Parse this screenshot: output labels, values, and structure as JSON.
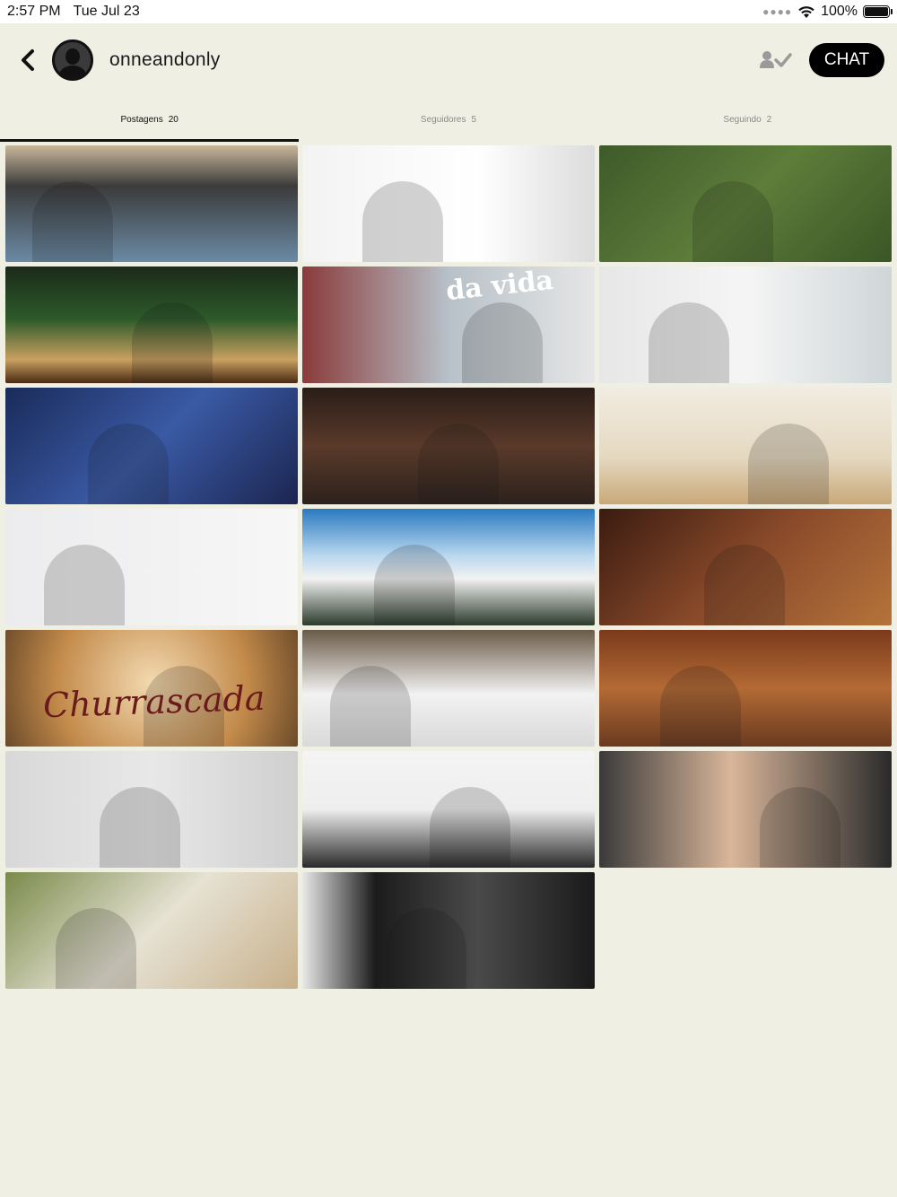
{
  "status_bar": {
    "time": "2:57 PM",
    "date": "Tue Jul 23",
    "battery": "100%"
  },
  "header": {
    "username": "onneandonly",
    "chat_label": "CHAT"
  },
  "tabs": [
    {
      "label": "Postagens",
      "count": "20",
      "active": true
    },
    {
      "label": "Seguidores",
      "count": "5",
      "active": false
    },
    {
      "label": "Seguindo",
      "count": "2",
      "active": false
    }
  ],
  "posts": [
    {
      "name": "post-1",
      "bg": "linear-gradient(180deg,#c9b79a 0%,#3b3b3b 35%,#6b8aa5 100%)"
    },
    {
      "name": "post-2",
      "bg": "linear-gradient(90deg,#f3f3f3 0%,#ffffff 60%,#dcdcdc 100%)"
    },
    {
      "name": "post-3",
      "bg": "linear-gradient(135deg,#3e5a2a 0%,#5d7d3a 50%,#3a5626 100%)"
    },
    {
      "name": "post-4",
      "bg": "linear-gradient(180deg,#1b2a1a 0%,#2d5a2a 45%,#c9a060 80%,#4a2a14 100%)"
    },
    {
      "name": "post-5",
      "bg": "linear-gradient(90deg,#8a3a3a 0%,#b7c1c8 50%,#e6e6e6 100%)",
      "text": "da vida"
    },
    {
      "name": "post-6",
      "bg": "linear-gradient(90deg,#e7e7e7 0%,#f5f5f5 50%,#cfd6d8 100%)"
    },
    {
      "name": "post-7",
      "bg": "linear-gradient(135deg,#1a2b5a 0%,#3a5aa5 50%,#1b2550 100%)"
    },
    {
      "name": "post-8",
      "bg": "linear-gradient(180deg,#2a1d18 0%,#5a3a2a 50%,#2c211c 100%)"
    },
    {
      "name": "post-9",
      "bg": "linear-gradient(180deg,#f1ece2 0%,#e5d8c0 60%,#c9a878 100%)"
    },
    {
      "name": "post-10",
      "bg": "linear-gradient(90deg,#ececee 0%,#f7f7f7 100%)"
    },
    {
      "name": "post-11",
      "bg": "linear-gradient(180deg,#2a7ac0 0%,#b9d7ee 40%,#f2f2f2 60%,#2b3a2a 100%)"
    },
    {
      "name": "post-12",
      "bg": "linear-gradient(135deg,#3a1b10 0%,#8a4a2a 50%,#b5733a 100%)"
    },
    {
      "name": "post-13",
      "bg": "radial-gradient(circle at 50% 45%,#f3d9b0 0%,#c28a4a 60%,#6b4a2a 100%)",
      "text": "Churrascada"
    },
    {
      "name": "post-14",
      "bg": "linear-gradient(180deg,#6a5a48 0%,#f2f2f2 55%,#d9d9d9 100%)"
    },
    {
      "name": "post-15",
      "bg": "linear-gradient(180deg,#7a3a1b 0%,#b36a35 50%,#6a3a20 100%)"
    },
    {
      "name": "post-16",
      "bg": "linear-gradient(90deg,#d8d8d8 0%,#e8e8e8 50%,#cfcfcf 100%)"
    },
    {
      "name": "post-17",
      "bg": "linear-gradient(180deg,#f4f4f4 0%,#eeeeee 50%,#2a2a2a 100%)"
    },
    {
      "name": "post-18",
      "bg": "linear-gradient(90deg,#3a3a3a 0%,#d9b69a 45%,#2a2a2a 100%)"
    },
    {
      "name": "post-19",
      "bg": "linear-gradient(135deg,#7a8a4a 0%,#e6e2d4 50%,#c7b08a 100%)"
    },
    {
      "name": "post-20",
      "bg": "linear-gradient(90deg,#e9e9e9 0%,#1b1b1b 25%,#4a4a4a 60%,#1a1a1a 100%)"
    }
  ]
}
